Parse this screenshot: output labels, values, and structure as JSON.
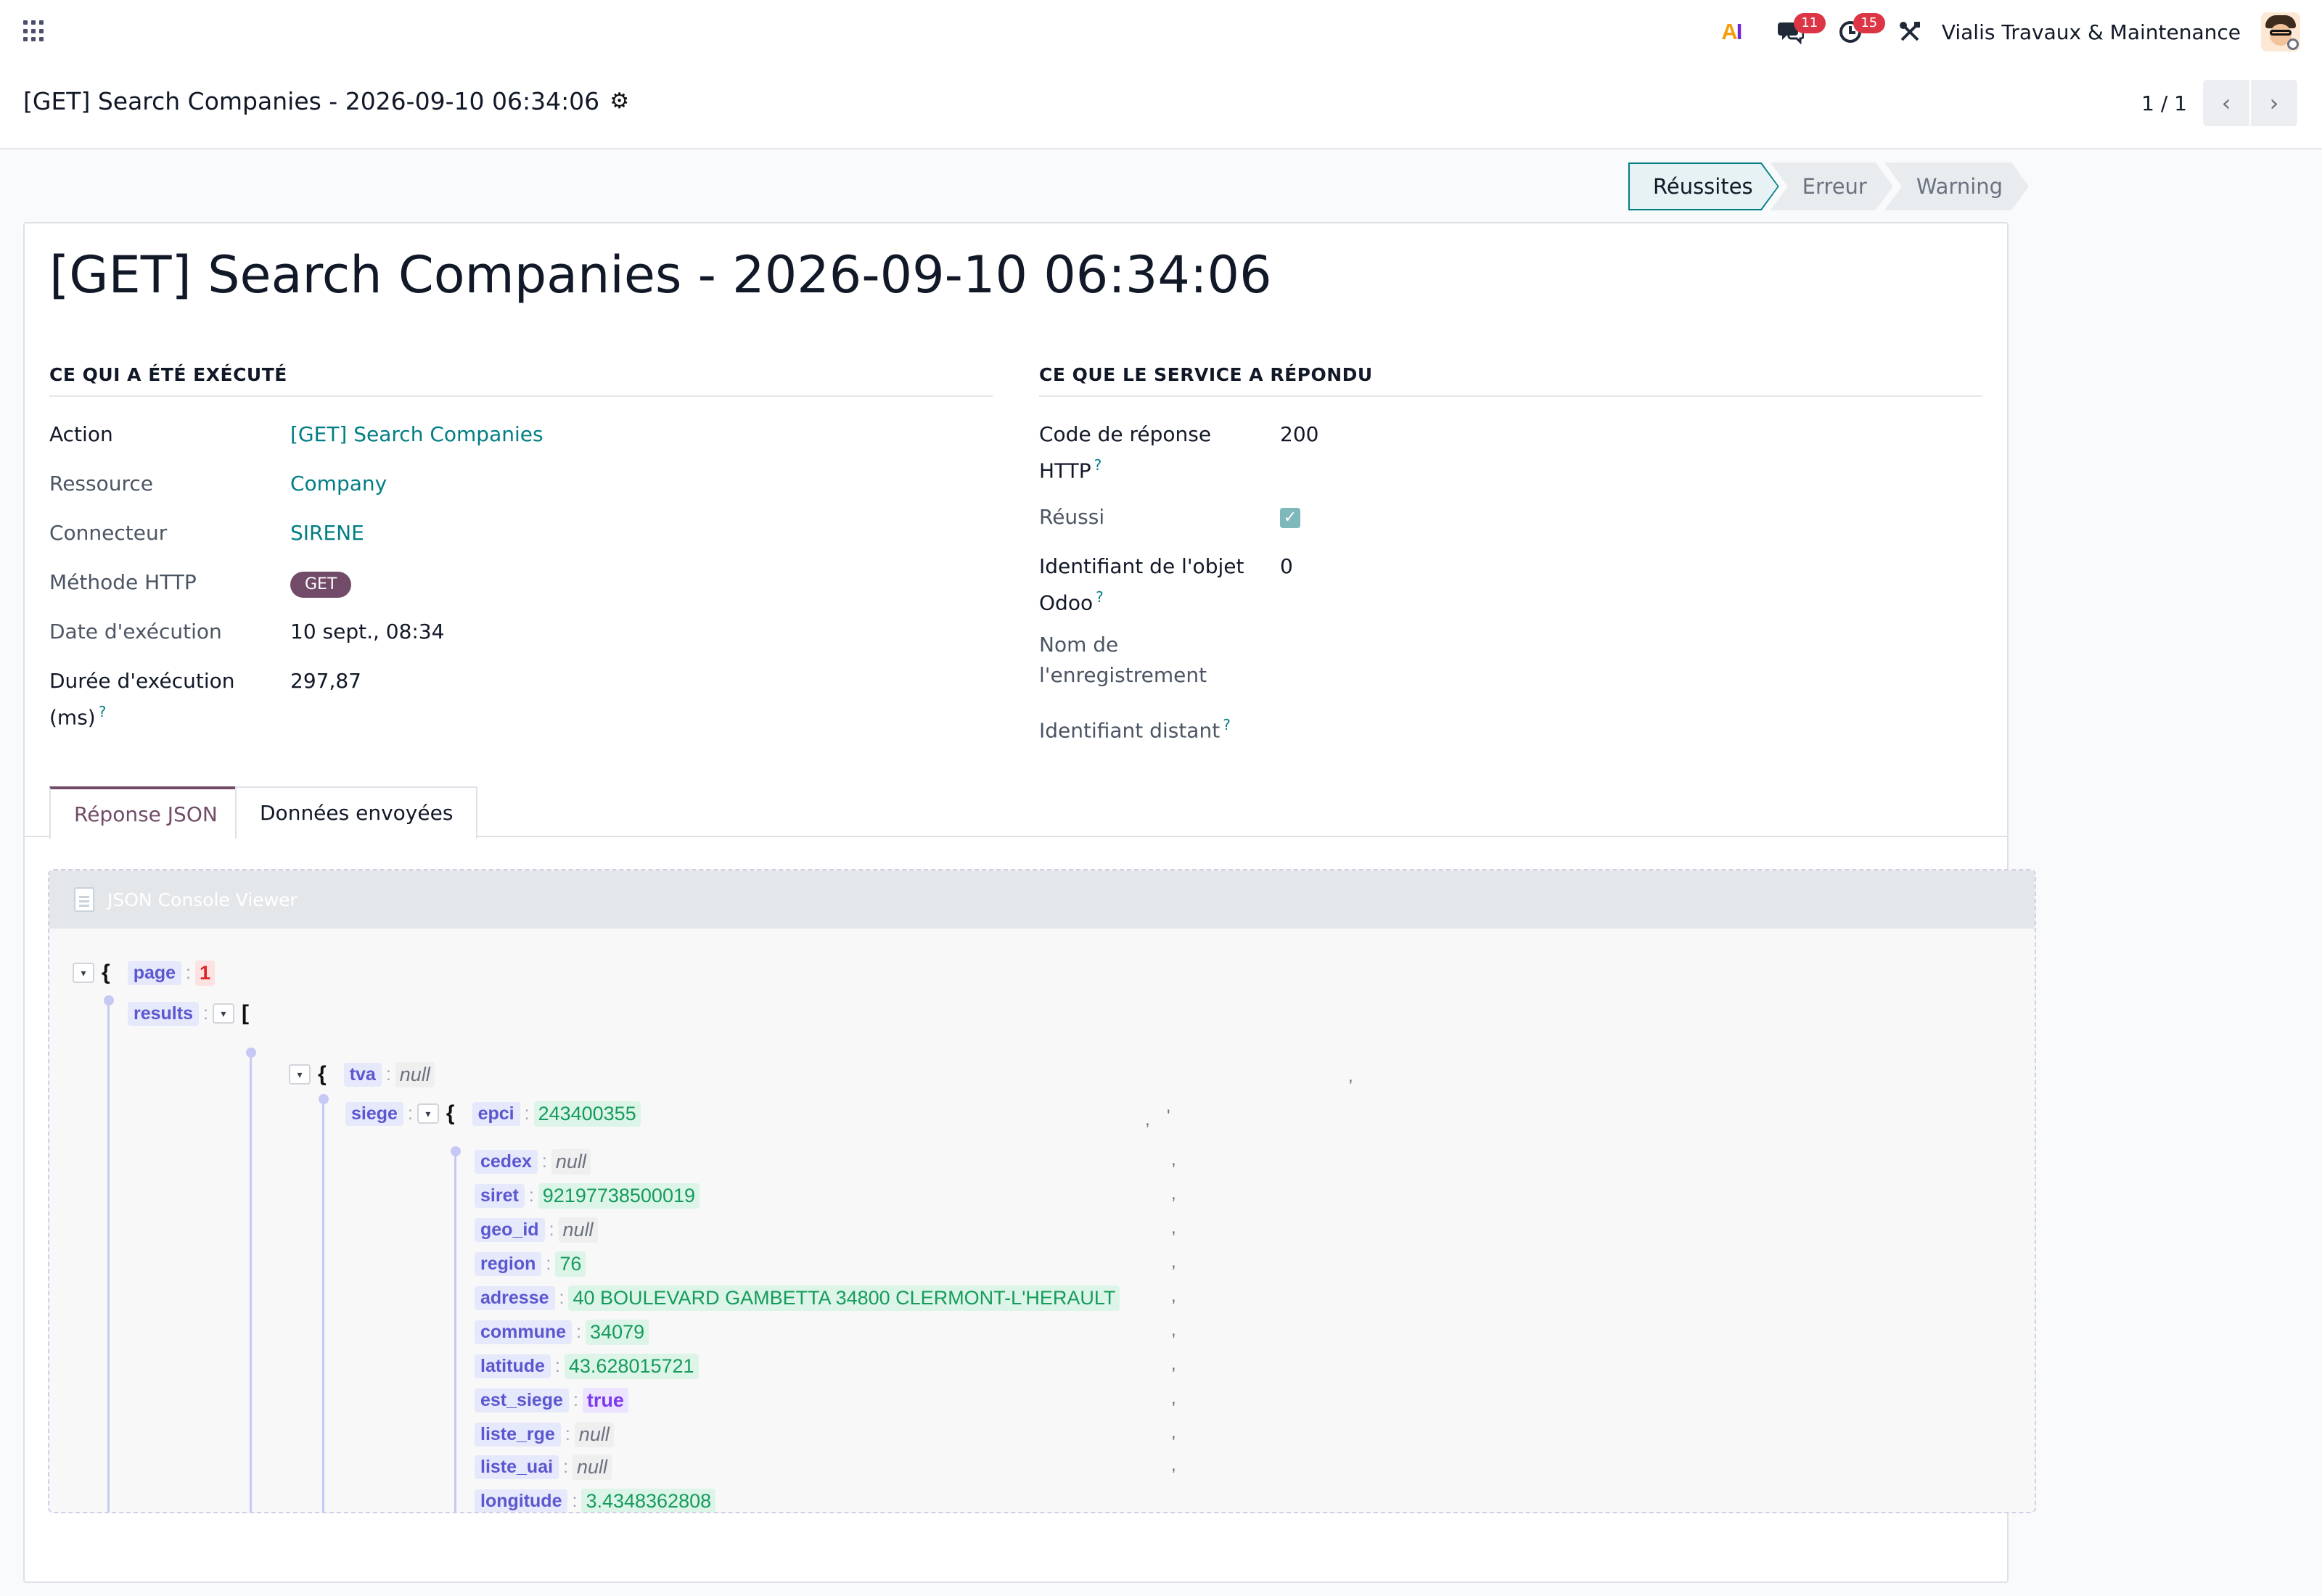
{
  "navbar": {
    "company": "Vialis Travaux & Maintenance",
    "messages_count": "11",
    "activities_count": "15",
    "ai_label_a": "A",
    "ai_label_i": "I"
  },
  "control_panel": {
    "breadcrumb": "[GET] Search Companies - 2026-09-10 06:34:06",
    "pager": "1 / 1"
  },
  "statusbar": {
    "stages": [
      "Réussites",
      "Erreur",
      "Warning"
    ],
    "active": "Réussites"
  },
  "form": {
    "title": "[GET] Search Companies - 2026-09-10 06:34:06",
    "left_group": {
      "title": "CE QUI A ÉTÉ EXÉCUTÉ",
      "action_label": "Action",
      "action_value": "[GET] Search Companies",
      "resource_label": "Ressource",
      "resource_value": "Company",
      "connector_label": "Connecteur",
      "connector_value": "SIRENE",
      "method_label": "Méthode HTTP",
      "method_value": "GET",
      "date_label": "Date d'exécution",
      "date_value": "10 sept., 08:34",
      "duration_label_1": "Durée d'exécution",
      "duration_label_2": "(ms)",
      "duration_value": "297,87",
      "help_mark": "?"
    },
    "right_group": {
      "title": "CE QUE LE SERVICE A RÉPONDU",
      "code_label_1": "Code de réponse",
      "code_label_2": "HTTP",
      "code_value": "200",
      "success_label": "Réussi",
      "success_value": true,
      "odoo_id_label_1": "Identifiant de l'objet",
      "odoo_id_label_2": "Odoo",
      "odoo_id_value": "0",
      "record_name_label_1": "Nom de",
      "record_name_label_2": "l'enregistrement",
      "remote_id_label": "Identifiant distant"
    }
  },
  "tabs": [
    {
      "label": "Réponse JSON",
      "active": true
    },
    {
      "label": "Données envoyées",
      "active": false
    }
  ],
  "json_viewer": {
    "title": "JSON Console Viewer",
    "lines": {
      "page_key": "page",
      "page_val": "1",
      "results_key": "results",
      "tva_key": "tva",
      "tva_val": "null",
      "siege_key": "siege",
      "epci_key": "epci",
      "epci_val": "243400355",
      "cedex_key": "cedex",
      "cedex_val": "null",
      "siret_key": "siret",
      "siret_val": "92197738500019",
      "geo_id_key": "geo_id",
      "geo_id_val": "null",
      "region_key": "region",
      "region_val": "76",
      "adresse_key": "adresse",
      "adresse_val": "40 BOULEVARD GAMBETTA 34800 CLERMONT-L'HERAULT",
      "commune_key": "commune",
      "commune_val": "34079",
      "latitude_key": "latitude",
      "latitude_val": "43.628015721",
      "est_siege_key": "est_siege",
      "est_siege_val": "true",
      "liste_rge_key": "liste_rge",
      "liste_rge_val": "null",
      "liste_uai_key": "liste_uai",
      "liste_uai_val": "null",
      "longitude_key": "longitude",
      "longitude_val": "3.4348362808"
    }
  },
  "colors": {
    "primary": "#714b67",
    "link": "#017e84",
    "badge": "#dc3545"
  }
}
